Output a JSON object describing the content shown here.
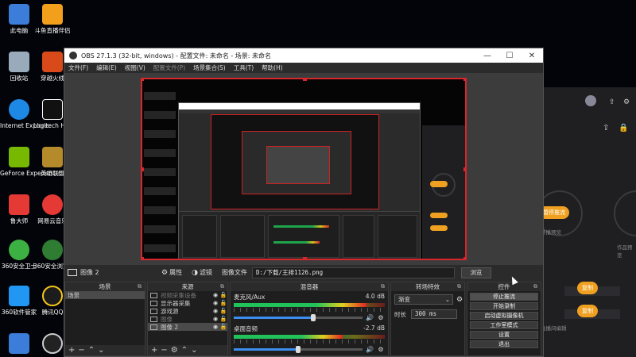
{
  "desktop": {
    "icons": [
      {
        "label": "此电脑",
        "color": "#3b7dd8"
      },
      {
        "label": "斗鱼直播伴侣",
        "color": "#f2a01c"
      },
      {
        "label": "回收站",
        "color": "#9ab"
      },
      {
        "label": "穿越火线",
        "color": "#d84a1a"
      },
      {
        "label": "Internet Explorer",
        "color": "#1e88e5"
      },
      {
        "label": "Logitech HUB",
        "color": "#111"
      },
      {
        "label": "GeForce Experience",
        "color": "#76b900"
      },
      {
        "label": "英雄联盟",
        "color": "#b58a2a"
      },
      {
        "label": "鲁大师",
        "color": "#e53935"
      },
      {
        "label": "网易云音乐",
        "color": "#e53935"
      },
      {
        "label": "360安全卫士",
        "color": "#3cb043"
      },
      {
        "label": "360安全浏览器",
        "color": "#2e7d32"
      },
      {
        "label": "360软件管家",
        "color": "#2196f3"
      },
      {
        "label": "腾讯QQ",
        "color": "#1c1c1c"
      }
    ]
  },
  "rightapp": {
    "pill1": "暂停推流",
    "pill2": "复制",
    "pill3": "复制",
    "text1": "开播预览",
    "text2": "作品预览",
    "text3": "直播间编辑"
  },
  "obs": {
    "title": "OBS 27.1.3 (32-bit, windows) - 配置文件: 未命名 - 场景: 未命名",
    "window_buttons": [
      "—",
      "☐",
      "✕"
    ],
    "menu": [
      "文件(F)",
      "编辑(E)",
      "视图(V)",
      "配置文件(P)",
      "场景集合(S)",
      "工具(T)",
      "帮助(H)"
    ],
    "source_bar": {
      "name": "图像 2",
      "properties": "属性",
      "filters": "滤镜",
      "file_label": "图像文件",
      "path": "D:/下载/王排1126.png",
      "browse": "浏览"
    },
    "docks": {
      "scenes": {
        "title": "场景",
        "items": [
          "场景"
        ]
      },
      "sources": {
        "title": "来源",
        "items": [
          {
            "name": "视频采集设备",
            "dim": true
          },
          {
            "name": "显示器采集",
            "dim": false
          },
          {
            "name": "游戏源",
            "dim": false
          },
          {
            "name": "图像",
            "dim": true
          },
          {
            "name": "图像 2",
            "dim": false
          }
        ]
      },
      "mixer": {
        "title": "混音器",
        "channels": [
          {
            "name": "麦克风/Aux",
            "db": "4.0 dB",
            "level": 0.88,
            "volume": 0.62
          },
          {
            "name": "桌面音频",
            "db": "-2.7 dB",
            "level": 0.72,
            "volume": 0.5
          }
        ]
      },
      "transitions": {
        "title": "转场特效",
        "type": "渐变",
        "duration_label": "时长",
        "duration": "300 ms"
      },
      "controls": {
        "title": "控件",
        "buttons": [
          "停止推流",
          "开始录制",
          "启动虚拟摄像机",
          "工作室模式",
          "设置",
          "退出"
        ]
      }
    }
  },
  "colors": {
    "selection_red": "#d8262b",
    "meter_green": "#22c25a",
    "accent_orange": "#f0a020"
  }
}
